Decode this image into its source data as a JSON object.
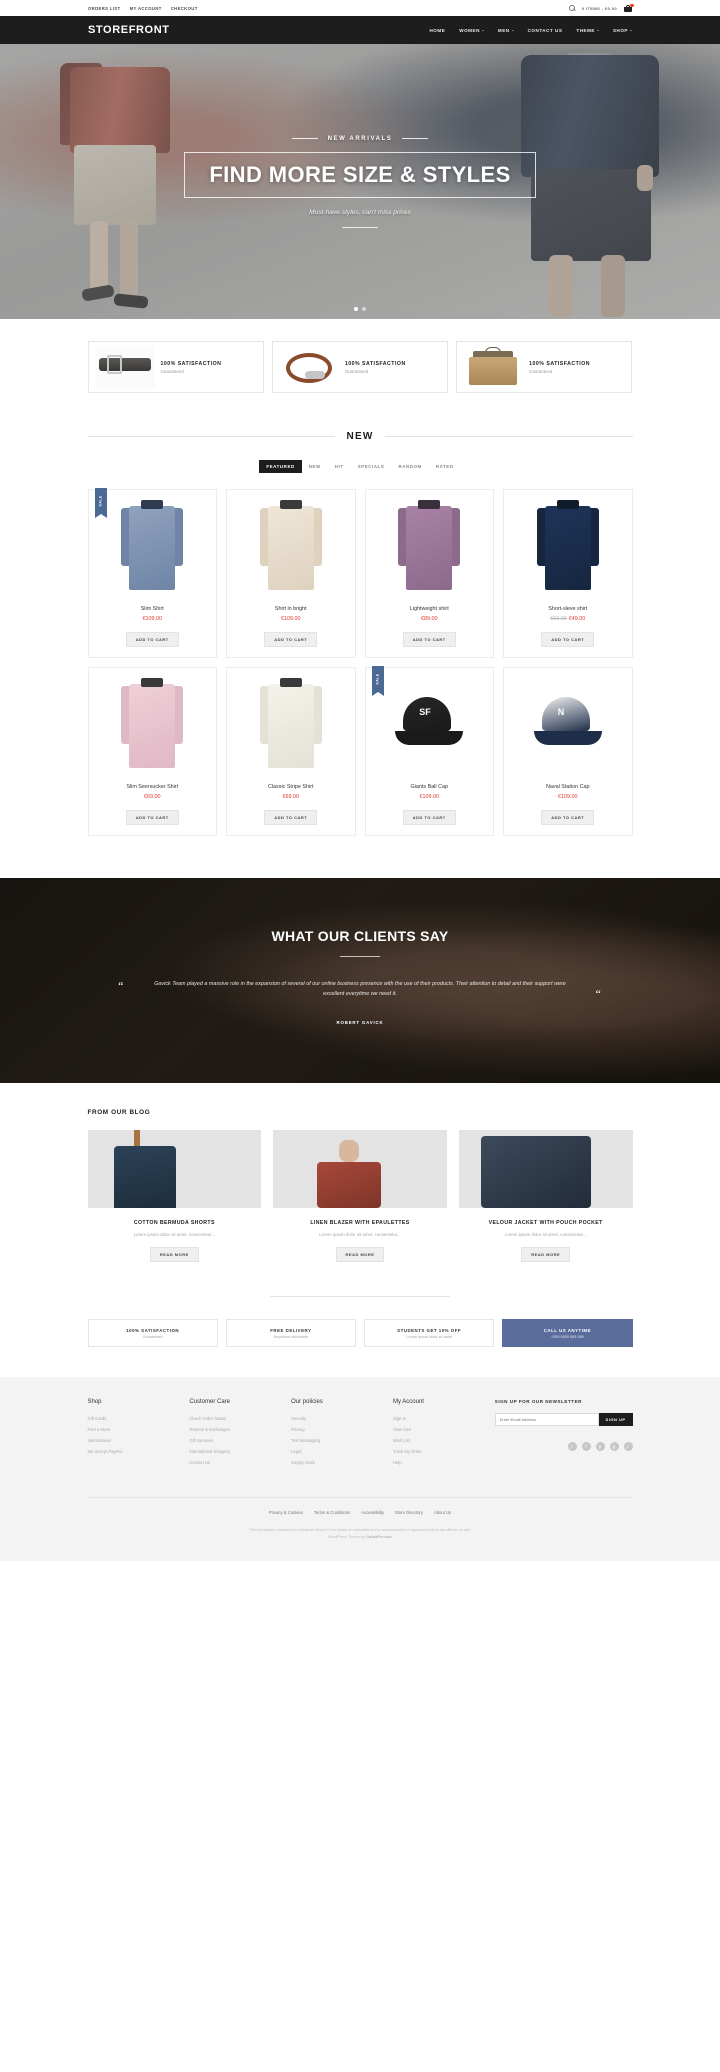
{
  "topbar": {
    "links": [
      "ORDERS LIST",
      "MY ACCOUNT",
      "CHECKOUT"
    ],
    "search_icon": "search-icon",
    "cart_summary": "0 ITEMS - €0.00",
    "cart_icon": "shopping-cart-icon",
    "cart_badge": "0"
  },
  "header": {
    "logo": "STOREFRONT",
    "nav": [
      {
        "label": "HOME",
        "has_dropdown": false
      },
      {
        "label": "WOMEN",
        "has_dropdown": true
      },
      {
        "label": "MEN",
        "has_dropdown": true
      },
      {
        "label": "CONTACT US",
        "has_dropdown": false
      },
      {
        "label": "THEME",
        "has_dropdown": true
      },
      {
        "label": "SHOP",
        "has_dropdown": true
      }
    ]
  },
  "hero": {
    "eyebrow": "NEW ARRIVALS",
    "title": "FIND MORE SIZE & STYLES",
    "subtitle": "Must-have styles, can't miss prices",
    "slides": 2,
    "active_slide": 1
  },
  "badges": [
    {
      "title": "100% SATISFACTION",
      "sub": "Guaranteed",
      "image": "leather-belt-image"
    },
    {
      "title": "100% SATISFACTION",
      "sub": "Guaranteed",
      "image": "leather-bracelet-image"
    },
    {
      "title": "100% SATISFACTION",
      "sub": "Guaranteed",
      "image": "canvas-bag-image"
    }
  ],
  "new_section": {
    "title": "NEW",
    "tabs": [
      "FEATURED",
      "NEW",
      "HIT",
      "SPECIALS",
      "RANDOM",
      "RATED"
    ],
    "active_tab": "FEATURED",
    "add_to_cart_label": "ADD TO CART",
    "products": [
      {
        "name": "Slim Shirt",
        "price": "€109.00",
        "old_price": "",
        "ribbon": "SALE",
        "kind": "shirt",
        "c1": "#8fa2bd",
        "c2": "#6f85a6",
        "collar": "#2e3c52"
      },
      {
        "name": "Shirt in bright",
        "price": "€109.00",
        "old_price": "",
        "ribbon": "",
        "kind": "shirt",
        "c1": "#efe6d8",
        "c2": "#ded2bf",
        "collar": "#3a3a3a"
      },
      {
        "name": "Lightweight shirt",
        "price": "€89.00",
        "old_price": "",
        "ribbon": "",
        "kind": "shirt",
        "c1": "#a882a6",
        "c2": "#8c6a8c",
        "collar": "#3a2f3c"
      },
      {
        "name": "Short-sleve shirt",
        "price": "€49.00",
        "old_price": "€69.00",
        "ribbon": "",
        "kind": "shirt",
        "c1": "#1e3459",
        "c2": "#16263f",
        "collar": "#101b2c"
      },
      {
        "name": "Slim Seersucker Shirt",
        "price": "€69.00",
        "old_price": "",
        "ribbon": "",
        "kind": "shirt",
        "c1": "#efcfd8",
        "c2": "#dfb8c4",
        "collar": "#3a3a3a"
      },
      {
        "name": "Classic Stripe Shirt",
        "price": "€69.00",
        "old_price": "",
        "ribbon": "",
        "kind": "shirt",
        "c1": "#f4f2ea",
        "c2": "#e4e1d6",
        "collar": "#3a3a3a"
      },
      {
        "name": "Giants Ball Cap",
        "price": "€109.00",
        "old_price": "",
        "ribbon": "SALE",
        "kind": "cap",
        "c1": "#262626",
        "c2": "#1a1a1a",
        "logo": "SF"
      },
      {
        "name": "Naval Station Cap",
        "price": "€109.00",
        "old_price": "",
        "ribbon": "",
        "kind": "cap",
        "c1": "#f2f2f2",
        "c2": "#1e2e4a",
        "logo": "N"
      }
    ]
  },
  "testimonial": {
    "heading": "WHAT OUR CLIENTS SAY",
    "quote": "Gavick Team played a massive role in the expansion of several of our online business presence with the use of their products. Their attention to detail and their support were excellent everytime we need it.",
    "author": "ROBERT GAVICK",
    "quote_mark": "“"
  },
  "blog": {
    "heading": "FROM OUR BLOG",
    "read_more_label": "READ MORE",
    "posts": [
      {
        "title": "COTTON BERMUDA SHORTS",
        "excerpt": "Lorem ipsum dolor sit amet, consectetur...",
        "image": "bermuda-shorts-image"
      },
      {
        "title": "LINEN BLAZER WITH EPAULETTES",
        "excerpt": "Lorem ipsum dolor sit amet, consectetur...",
        "image": "linen-blazer-image"
      },
      {
        "title": "VELOUR JACKET WITH POUCH POCKET",
        "excerpt": "Lorem ipsum dolor sit amet, consectetur...",
        "image": "velour-jacket-image"
      }
    ]
  },
  "info_strip": [
    {
      "title": "100% SATISFACTION",
      "sub": "Guaranteed",
      "cta": false
    },
    {
      "title": "FREE DELIVERY",
      "sub": "Anywhere worldwide",
      "cta": false
    },
    {
      "title": "STUDENTS GET 10% OFF",
      "sub": "Lorem ipsum dolor sit amet",
      "cta": false
    },
    {
      "title": "CALL US ANYTIME",
      "sub": "+355 5555 555 555",
      "cta": true
    }
  ],
  "footer": {
    "columns": [
      {
        "heading": "Shop",
        "links": [
          "Gift Cards",
          "Find a Store",
          "International",
          "We accept PayPal"
        ]
      },
      {
        "heading": "Customer Care",
        "links": [
          "Check Order Status",
          "Returns & Exchanges",
          "Gift Services",
          "International Shipping",
          "Contact Us"
        ]
      },
      {
        "heading": "Our policies",
        "links": [
          "Security",
          "Privacy",
          "Text Messaging",
          "Legal",
          "Supply chain"
        ]
      },
      {
        "heading": "My Account",
        "links": [
          "Sign In",
          "View Cart",
          "Wish List",
          "Track My Order",
          "Help"
        ]
      }
    ],
    "newsletter": {
      "heading": "SIGN UP FOR OUR NEWSLETTER",
      "placeholder": "Enter Email Address",
      "value": "",
      "button": "SIGN UP"
    },
    "social": [
      {
        "name": "twitter-icon",
        "glyph": "t"
      },
      {
        "name": "facebook-icon",
        "glyph": "f"
      },
      {
        "name": "pinterest-icon",
        "glyph": "p"
      },
      {
        "name": "google-plus-icon",
        "glyph": "g"
      },
      {
        "name": "rss-icon",
        "glyph": "r"
      }
    ],
    "bottom_links": [
      "Privacy & Cookies",
      "Terms & Conditions",
      "Accessibility",
      "Store Directory",
      "About Us"
    ],
    "copyright_line1": "The information contained in Industrial Gavick Front Notice is estimated and is recommended or approved that terms offered on site.",
    "copyright_line2": "WordPress Theme by",
    "copyright_brand": "GavickPro.com"
  }
}
